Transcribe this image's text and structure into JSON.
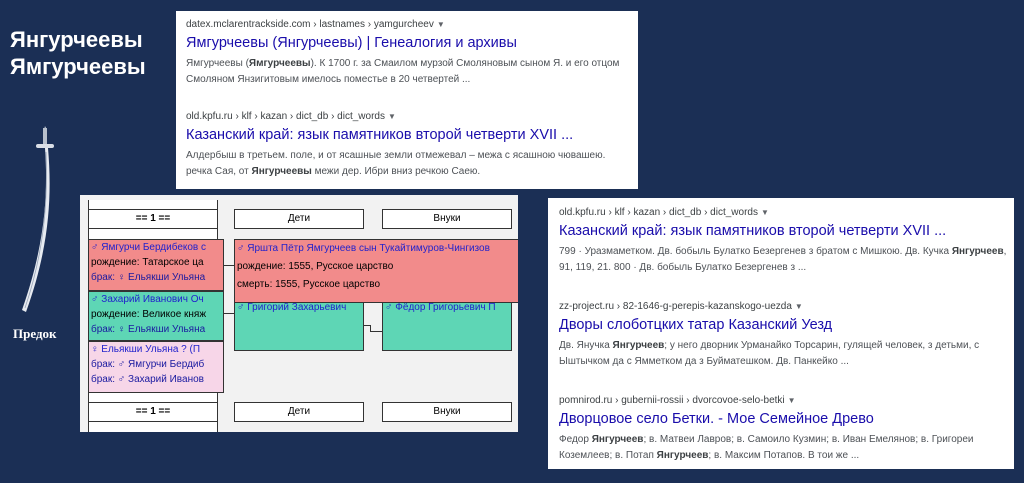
{
  "slide": {
    "title_line1": "Янгурчеевы",
    "title_line2": "Ямгурчеевы",
    "ancestor_label": "Предок",
    "saber_icon": "saber-icon"
  },
  "results_top": [
    {
      "url": "datex.mclarentrackside.com › lastnames › yamgurcheev",
      "title": "Ямгурчеевы (Янгурчеевы) | Генеалогия и архивы",
      "snippet_parts": [
        "Ямгурчеевы (",
        "Ямгурчеевы",
        "). К 1700 г. за Смаилом мурзой Смоляновым сыном Я. и его отцом Смоляном Янзигитовым имелось поместье в 20 четвертей ..."
      ]
    },
    {
      "url": "old.kpfu.ru › klf › kazan › dict_db › dict_words",
      "title": "Казанский край: язык памятников второй четверти XVII ...",
      "snippet_parts": [
        "Алдербыш в третьем. поле, и от ясашные земли отмежевал – межа с ясашною чювашею. речка Сая, от ",
        "Янгурчеевы",
        " межи дер. Ибри вниз речкою Саею."
      ]
    }
  ],
  "results_right": [
    {
      "url": "old.kpfu.ru › klf › kazan › dict_db › dict_words",
      "title": "Казанский край: язык памятников второй четверти XVII ...",
      "snippet_parts": [
        "799 · Уразмаметком. Дв. бобыль Булатко Безергенев з братом с Мишкою. Дв. Кучка ",
        "Янгурчеев",
        ", 91, 119, 21. 800 · Дв. бобыль Булатко Безергенев з ..."
      ]
    },
    {
      "url": "zz-project.ru › 82-1646-g-perepis-kazanskogo-uezda",
      "title": "Дворы слоботцких татар Казанский Уезд",
      "snippet_parts": [
        "Дв. Янучка ",
        "Янгурчеев",
        "; у него дворник Урманайко Торсарин, гулящей человек, з детьми, с Ыштычком да с Ямметком да з Буйматешком. Дв. Панкейко ..."
      ]
    },
    {
      "url": "pomnirod.ru › gubernii-rossii › dvorcovoe-selo-betki",
      "title": "Дворцовое село Бетки. - Мое Семейное Древо",
      "snippet_parts": [
        "Федор ",
        "Янгурчеев",
        "; в. Матвеи Лавров; в. Самоило Кузмин; в. Иван Емелянов; в. Григореи Коземлеев; в. Потап ",
        "Янгурчеев",
        "; в. Максим Потапов. В тои же ..."
      ]
    }
  ],
  "tree": {
    "gen1_header": "== 1 ==",
    "gen1_header_bottom": "== 1 ==",
    "children_header": "Дети",
    "grandchildren_header": "Внуки",
    "children_header_bottom": "Дети",
    "grandchildren_header_bottom": "Внуки",
    "p1_name": "♂ Ямгурчи Бердибеков с",
    "p1_birth": "рождение: Татарское ца",
    "p1_marriage": "брак: ♀ Ельякши Ульяна",
    "p2_name": "♂ Захарий Иванович Оч",
    "p2_birth": "рождение: Великое княж",
    "p2_marriage": "брак: ♀ Ельякши Ульяна",
    "p3_name": "♀ Ельякши Ульяна ? (П",
    "p3_marriage1": "брак: ♂ Ямгурчи Бердиб",
    "p3_marriage2": "брак: ♂ Захарий Иванов",
    "child1_name": "♂ Яршта Пётр Ямгурчеев сын Тукайтимуров-Чингизов",
    "child1_birth": "рождение: 1555, Русское царство",
    "child1_death": "смерть: 1555, Русское царство",
    "child2_name": "♂ Григорий Захарьевич",
    "grandchild_name": "♂ Фёдор Григорьевич П"
  }
}
